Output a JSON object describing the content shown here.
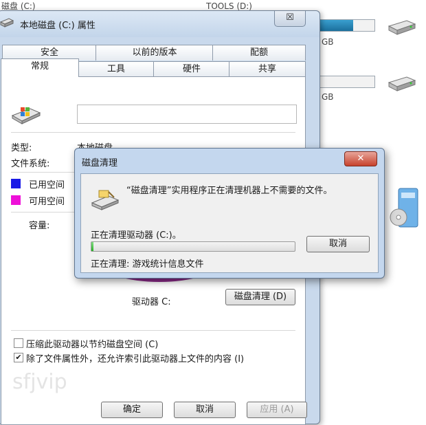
{
  "background_explorer": {
    "top_left_text": "磁盘 (C:)",
    "top_drive_label": "TOOLS (D:)",
    "gb_label_1": "GB",
    "gb_label_2": "GB",
    "drive_bar_1_fill": 0.62,
    "drive_bar_2_fill": 0.0
  },
  "properties_window": {
    "title": "本地磁盘 (C:) 属性",
    "close_glyph": "☒",
    "tabs_row1": [
      "安全",
      "以前的版本",
      "配额"
    ],
    "tabs_row2": [
      "常规",
      "工具",
      "硬件",
      "共享"
    ],
    "active_tab": "常规",
    "volume_name_value": "",
    "type_label": "类型:",
    "type_value": "本地磁盘",
    "fs_label": "文件系统:",
    "used_space_label": "已用空间",
    "free_space_label": "可用空间",
    "used_color": "#1a1ae6",
    "free_color": "#ee10d8",
    "capacity_label": "容量:",
    "drive_label": "驱动器 C:",
    "disk_cleanup_button": "磁盘清理 (D)",
    "compress_option": "压缩此驱动器以节约磁盘空间 (C)",
    "compress_checked": false,
    "index_option": "除了文件属性外，还允许索引此驱动器上文件的内容 (I)",
    "index_checked": true,
    "watermark": "sfjvip",
    "ok_button": "确定",
    "cancel_button": "取消",
    "apply_button": "应用 (A)"
  },
  "cleanup_dialog": {
    "title": "磁盘清理",
    "close_glyph": "✕",
    "message": "“磁盘清理”实用程序正在清理机器上不需要的文件。",
    "cleaning_drive": "正在清理驱动器   (C:)。",
    "cancel_button": "取消",
    "progress": 0.01,
    "status_text": "正在清理:  游戏统计信息文件"
  }
}
